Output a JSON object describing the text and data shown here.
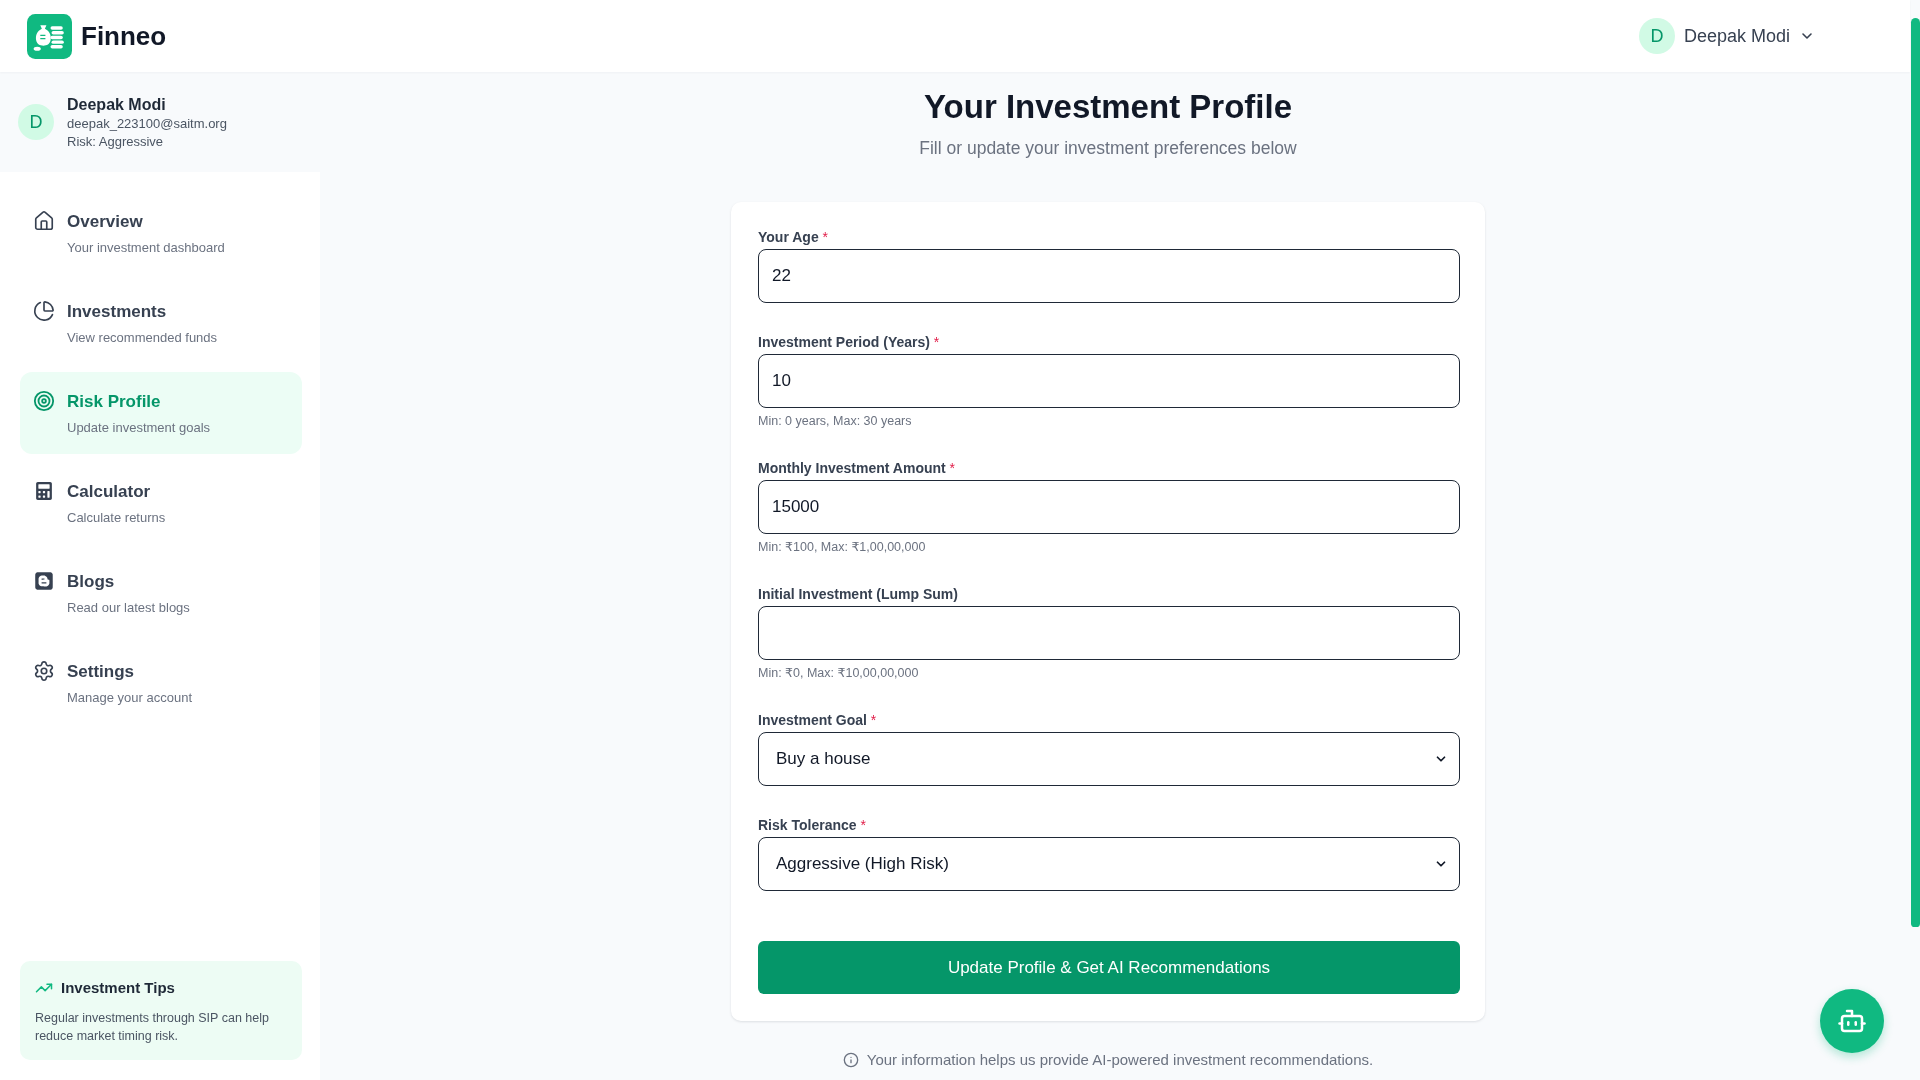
{
  "header": {
    "brand": "Finneo",
    "user": {
      "initial": "D",
      "name": "Deepak Modi"
    }
  },
  "sidebar": {
    "profile": {
      "initial": "D",
      "name": "Deepak Modi",
      "email": "deepak_223100@saitm.org",
      "risk": "Risk: Aggressive"
    },
    "items": [
      {
        "title": "Overview",
        "subtitle": "Your investment dashboard",
        "selected": false
      },
      {
        "title": "Investments",
        "subtitle": "View recommended funds",
        "selected": false
      },
      {
        "title": "Risk Profile",
        "subtitle": "Update investment goals",
        "selected": true
      },
      {
        "title": "Calculator",
        "subtitle": "Calculate returns",
        "selected": false
      },
      {
        "title": "Blogs",
        "subtitle": "Read our latest blogs",
        "selected": false
      },
      {
        "title": "Settings",
        "subtitle": "Manage your account",
        "selected": false
      }
    ],
    "tips": {
      "title": "Investment Tips",
      "text": "Regular investments through SIP can help reduce market timing risk."
    }
  },
  "page": {
    "title": "Your Investment Profile",
    "subtitle": "Fill or update your investment preferences below"
  },
  "form": {
    "fields": [
      {
        "kind": "input",
        "label": "Your Age",
        "required_mark": "*",
        "value": "22"
      },
      {
        "kind": "input",
        "label": "Investment Period (Years)",
        "required_mark": "*",
        "value": "10",
        "hint": "Min: 0 years, Max: 30 years"
      },
      {
        "kind": "input",
        "label": "Monthly Investment Amount",
        "required_mark": "*",
        "value": "15000",
        "hint": "Min: ₹100, Max: ₹1,00,00,000"
      },
      {
        "kind": "input",
        "label": "Initial Investment (Lump Sum)",
        "hint": "Min: ₹0, Max: ₹10,00,00,000"
      },
      {
        "kind": "select",
        "label": "Investment Goal",
        "required_mark": "*",
        "value": "Buy a house"
      },
      {
        "kind": "select",
        "label": "Risk Tolerance",
        "required_mark": "*",
        "value": "Aggressive (High Risk)"
      }
    ],
    "submit": "Update Profile & Get AI Recommendations"
  },
  "note": "Your information helps us provide AI-powered investment recommendations."
}
